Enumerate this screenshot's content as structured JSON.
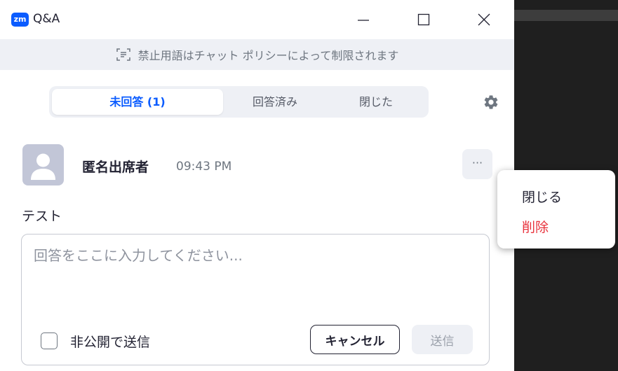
{
  "app": {
    "logo_text": "zm",
    "title": "Q&A",
    "brand_color": "#0b5cff"
  },
  "window_controls": [
    "minimize-icon",
    "maximize-icon",
    "close-icon"
  ],
  "banner": {
    "icon": "chat-filter-icon",
    "text": "禁止用語はチャット ポリシーによって制限されます"
  },
  "tabs": [
    {
      "label": "未回答 (1)",
      "active": true
    },
    {
      "label": "回答済み",
      "active": false
    },
    {
      "label": "閉じた",
      "active": false
    }
  ],
  "settings_icon": "gear-icon",
  "question": {
    "asker": "匿名出席者",
    "time": "09:43 PM",
    "text": "テスト",
    "more_label": "···"
  },
  "answer": {
    "placeholder": "回答をここに入力してください...",
    "private_label": "非公開で送信",
    "private_checked": false,
    "cancel_label": "キャンセル",
    "send_label": "送信"
  },
  "context_menu": {
    "items": [
      {
        "label": "閉じる",
        "color": "#232333"
      },
      {
        "label": "削除",
        "color": "#e8323c"
      }
    ]
  }
}
